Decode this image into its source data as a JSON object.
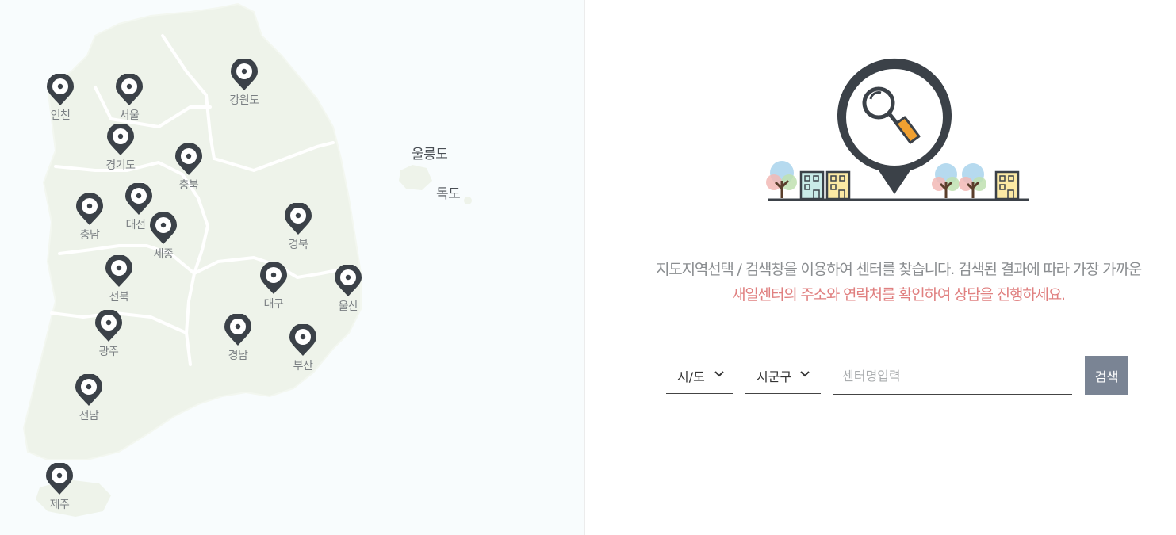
{
  "map": {
    "regions": [
      {
        "id": "incheon",
        "label": "인천"
      },
      {
        "id": "seoul",
        "label": "서울"
      },
      {
        "id": "gangwon",
        "label": "강원도"
      },
      {
        "id": "gyeonggi",
        "label": "경기도"
      },
      {
        "id": "chungbuk",
        "label": "충북"
      },
      {
        "id": "chungnam",
        "label": "충남"
      },
      {
        "id": "daejeon",
        "label": "대전"
      },
      {
        "id": "sejong",
        "label": "세종"
      },
      {
        "id": "gyeongbuk",
        "label": "경북"
      },
      {
        "id": "jeonbuk",
        "label": "전북"
      },
      {
        "id": "daegu",
        "label": "대구"
      },
      {
        "id": "ulsan",
        "label": "울산"
      },
      {
        "id": "gwangju",
        "label": "광주"
      },
      {
        "id": "gyeongnam",
        "label": "경남"
      },
      {
        "id": "busan",
        "label": "부산"
      },
      {
        "id": "jeonnam",
        "label": "전남"
      },
      {
        "id": "jeju",
        "label": "제주"
      }
    ],
    "islands": {
      "ulleungdo": "울릉도",
      "dokdo": "독도"
    }
  },
  "description": {
    "line1": "지도지역선택 / 검색창을 이용하여 센터를 찾습니다. 검색된 결과에 따라 가장 가까운",
    "line2": "새일센터의 주소와 연락처를 확인하여 상담을 진행하세요."
  },
  "search": {
    "sido_label": "시/도",
    "sigungu_label": "시군구",
    "input_placeholder": "센터명입력",
    "input_value": "",
    "button_label": "검색"
  },
  "colors": {
    "pin": "#3b4148",
    "search_button": "#7a8494",
    "highlight_text": "#e08080",
    "map_land": "#eef3ea"
  }
}
